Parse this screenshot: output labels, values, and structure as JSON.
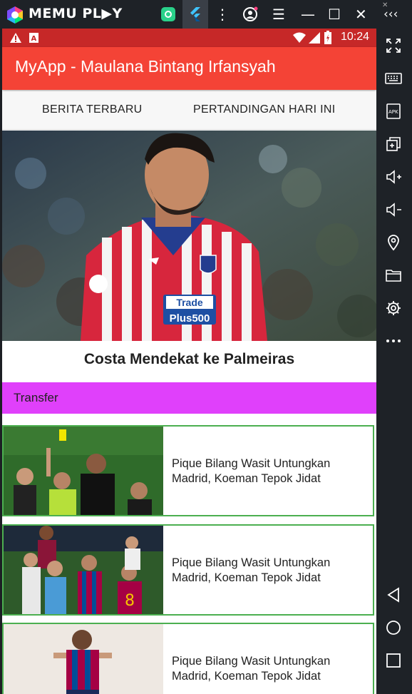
{
  "emulator": {
    "brand": "MEMU PL▶Y",
    "top_controls": [
      "⋮",
      "◉",
      "☰",
      "—",
      "☐",
      "✕",
      "‹‹‹"
    ]
  },
  "status_bar": {
    "time": "10:24"
  },
  "app_bar": {
    "title": "MyApp - Maulana Bintang Irfansyah"
  },
  "tabs": [
    {
      "label": "BERITA TERBARU"
    },
    {
      "label": "PERTANDINGAN HARI INI"
    }
  ],
  "featured": {
    "headline": "Costa Mendekat ke Palmeiras",
    "category": "Transfer",
    "jersey_text_1": "Trade",
    "jersey_text_2": "Plus500"
  },
  "news_list": [
    {
      "title": "Pique Bilang Wasit Untungkan Madrid, Koeman Tepok Jidat"
    },
    {
      "title": "Pique Bilang Wasit Untungkan Madrid, Koeman Tepok Jidat"
    },
    {
      "title": "Pique Bilang Wasit Untungkan Madrid, Koeman Tepok Jidat"
    }
  ],
  "colors": {
    "app_bar": "#f44336",
    "status_bar": "#c62828",
    "category_bg": "#e040fb",
    "card_border": "#4caf50"
  }
}
